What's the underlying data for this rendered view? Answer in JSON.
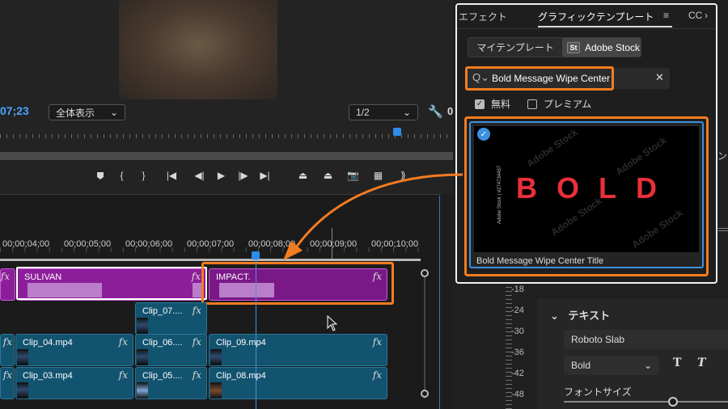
{
  "program_monitor": {
    "timecode": "07;23",
    "fit_label": "全体表示",
    "resolution_label": "1/2",
    "right_cutoff": "0"
  },
  "transport_icons": [
    "marker-icon",
    "mark-in-icon",
    "mark-out-icon",
    "go-to-in-icon",
    "step-back-icon",
    "play-icon",
    "step-forward-icon",
    "go-to-out-icon",
    "lift-icon",
    "extract-icon",
    "export-frame-icon",
    "comparison-icon",
    "settings-icon"
  ],
  "timeline": {
    "ruler_labels": [
      "00;00;04;00",
      "00;00;05;00",
      "00;00;06;00",
      "00;00;07;00",
      "00;00;08;00",
      "00;00;09;00",
      "00;00;10;00"
    ],
    "fx_label": "fx",
    "clips": {
      "graphic1": "SULIVAN",
      "graphic2": "IMPACT.",
      "v2_clip": "Clip_07....",
      "v1_a": "Clip_04.mp4",
      "v1_b": "Clip_06....",
      "v1_c": "Clip_09.mp4",
      "v0_a": "Clip_03.mp4",
      "v0_b": "Clip_05....",
      "v0_c": "Clip_08.mp4"
    }
  },
  "essential_graphics": {
    "tabs": [
      "エフェクト",
      "グラフィックテンプレート",
      "CC"
    ],
    "menu_icon": "≡",
    "segments": {
      "my_templates": "マイテンプレート",
      "adobe_stock": "Adobe Stock",
      "st_badge": "St"
    },
    "search": {
      "value": "Bold Message Wipe Center"
    },
    "filters": [
      {
        "label": "無料",
        "checked": true
      },
      {
        "label": "プレミアム",
        "checked": false
      }
    ],
    "result": {
      "art_text": "BOLD",
      "watermark": "Adobe Stock",
      "side_text": "Adobe Stock | #274734457",
      "title": "Bold Message Wipe Center Title"
    }
  },
  "properties": {
    "db_labels": [
      "-18",
      "-24",
      "-30",
      "-36",
      "-42",
      "-48"
    ],
    "section_title": "テキスト",
    "font_name": "Roboto Slab",
    "font_weight": "Bold",
    "text_styles": [
      "T",
      "T"
    ],
    "font_size_label": "フォントサイズ",
    "partial_text": "ン"
  },
  "colors": {
    "highlight": "#f47c20",
    "graphic_clip": "#8d1e9b",
    "video_clip": "#12536f",
    "playhead": "#2d8ceb",
    "title_red": "#e8303a"
  }
}
